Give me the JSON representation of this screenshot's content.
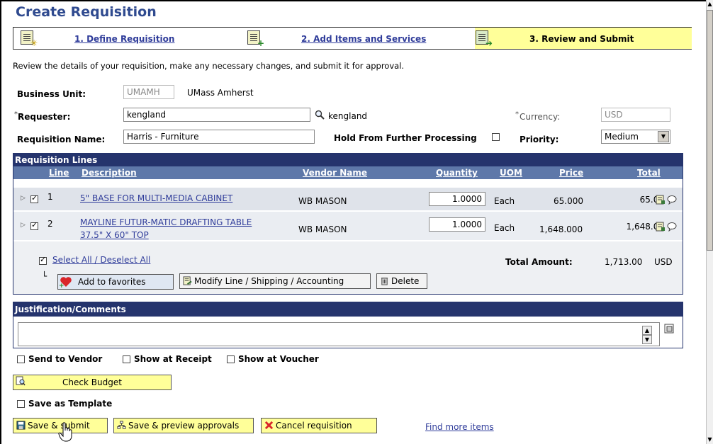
{
  "page": {
    "title": "Create Requisition",
    "intro": "Review the details of your requisition, make any necessary changes, and submit it for approval."
  },
  "steps": [
    {
      "label": "1. Define Requisition"
    },
    {
      "label": "2. Add Items and Services"
    },
    {
      "label": "3. Review and Submit"
    }
  ],
  "header_fields": {
    "business_unit_label": "Business Unit:",
    "business_unit_value": "UMAMH",
    "business_unit_name": "UMass Amherst",
    "requester_label": "Requester:",
    "requester_value": "kengland",
    "requester_lookup": "kengland",
    "currency_label": "Currency:",
    "currency_value": "USD",
    "req_name_label": "Requisition Name:",
    "req_name_value": "Harris - Furniture",
    "hold_label": "Hold From Further Processing",
    "priority_label": "Priority:",
    "priority_value": "Medium"
  },
  "lines": {
    "header": "Requisition Lines",
    "columns": {
      "line": "Line",
      "description": "Description",
      "vendor": "Vendor Name",
      "quantity": "Quantity",
      "uom": "UOM",
      "price": "Price",
      "total": "Total"
    },
    "rows": [
      {
        "line": "1",
        "description_1": "5\" BASE FOR MULTI-MEDIA CABINET",
        "description_2": "",
        "vendor": "WB MASON",
        "quantity": "1.0000",
        "uom": "Each",
        "price": "65.000",
        "total": "65.00"
      },
      {
        "line": "2",
        "description_1": "MAYLINE FUTUR-MATIC DRAFTING TABLE",
        "description_2": "37.5\" X 60\" TOP",
        "vendor": "WB MASON",
        "quantity": "1.0000",
        "uom": "Each",
        "price": "1,648.000",
        "total": "1,648.00"
      }
    ],
    "select_all": "Select All / Deselect All",
    "total_label": "Total Amount:",
    "total_value": "1,713.00",
    "total_currency": "USD",
    "buttons": {
      "favorites": "Add to favorites",
      "modify": "Modify Line / Shipping / Accounting",
      "delete": "Delete"
    }
  },
  "justification": {
    "header": "Justification/Comments",
    "text": "",
    "send_to_vendor": "Send to Vendor",
    "show_at_receipt": "Show at Receipt",
    "show_at_voucher": "Show at Voucher"
  },
  "footer": {
    "check_budget": "Check Budget",
    "save_template": "Save as Template",
    "save_submit": "Save & submit",
    "save_preview": "Save & preview approvals",
    "cancel": "Cancel requisition",
    "find_more": "Find more items"
  },
  "colors": {
    "title": "#2f4a8f",
    "header_bar": "#25346d",
    "column_bar": "#5e78a9",
    "active_step": "#ffff99",
    "link": "#2f3c9a"
  }
}
